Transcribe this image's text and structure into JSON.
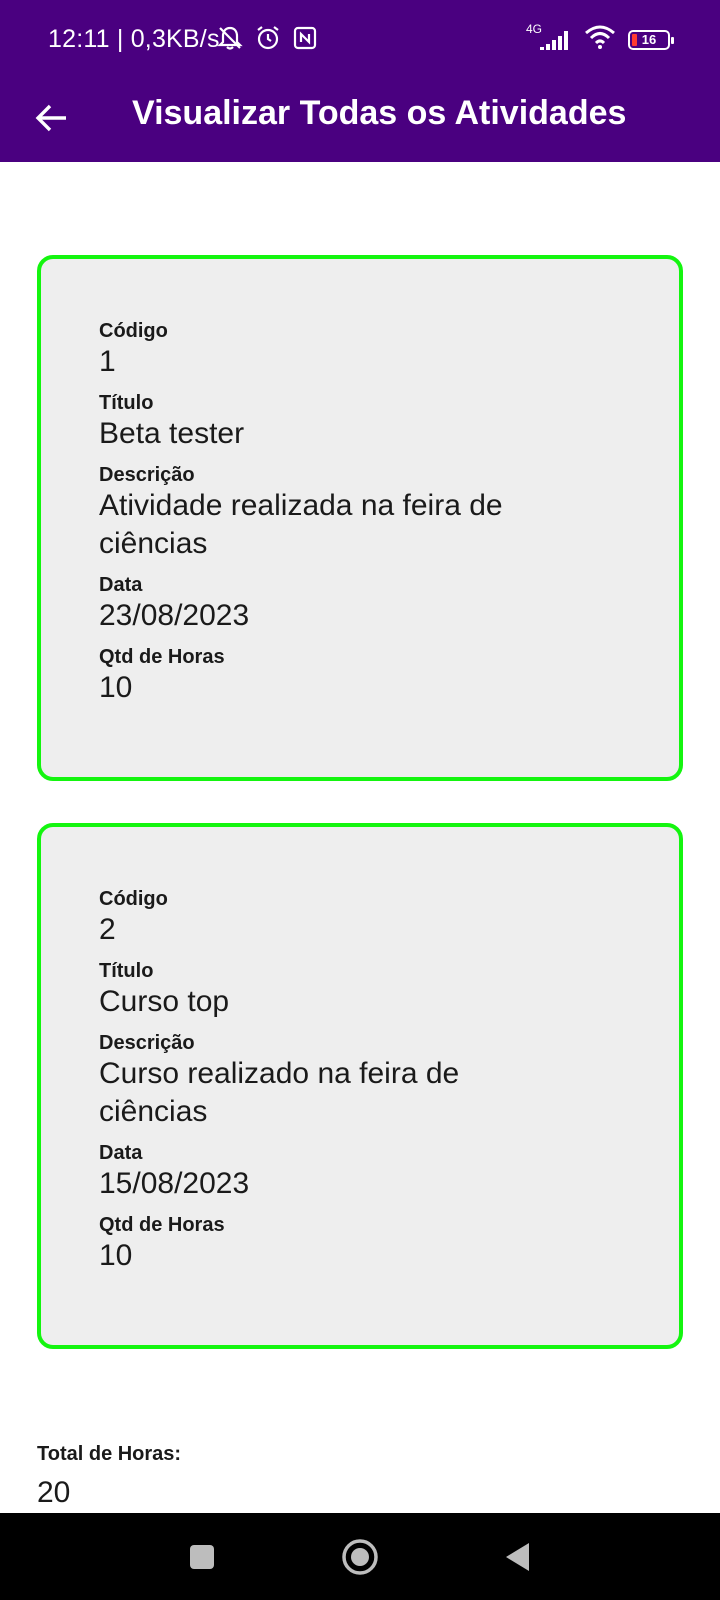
{
  "status_bar": {
    "time": "12:11 | 0,3KB/s",
    "network_type": "4G",
    "battery_level": "16",
    "icons": [
      "mute-notifications-icon",
      "alarm-icon",
      "nfc-icon",
      "signal-icon",
      "wifi-icon",
      "battery-icon"
    ]
  },
  "app_bar": {
    "title": "Visualizar Todas os Atividades",
    "back_icon": "arrow-left-icon"
  },
  "activities": [
    {
      "codigo_label": "Código",
      "codigo": "1",
      "titulo_label": "Título",
      "titulo": "Beta tester",
      "descricao_label": "Descrição",
      "descricao": "Atividade realizada na feira de ciências",
      "data_label": "Data",
      "data": "23/08/2023",
      "horas_label": "Qtd de Horas",
      "horas": "10"
    },
    {
      "codigo_label": "Código",
      "codigo": "2",
      "titulo_label": "Título",
      "titulo": "Curso top",
      "descricao_label": "Descrição",
      "descricao": "Curso realizado na feira de ciências",
      "data_label": "Data",
      "data": "15/08/2023",
      "horas_label": "Qtd de Horas",
      "horas": "10"
    }
  ],
  "total": {
    "label": "Total de Horas:",
    "value": "20"
  },
  "nav_bar": {
    "icons": [
      "recents-square-icon",
      "home-circle-icon",
      "back-triangle-icon"
    ]
  },
  "colors": {
    "header": "#4a0080",
    "card_border": "#14f50f",
    "card_background": "#eeeeee",
    "nav_bar": "#000000"
  }
}
